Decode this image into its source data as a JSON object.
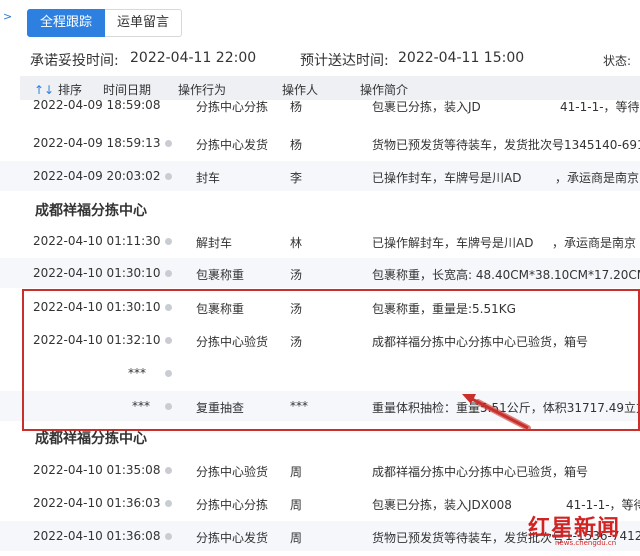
{
  "tabs": [
    {
      "label": "全程跟踪"
    },
    {
      "label": "运单留言"
    }
  ],
  "info": {
    "promise_label": "承诺妥投时间:",
    "promise_value": "2022-04-11 22:00",
    "eta_label": "预计送达时间:",
    "eta_value": "2022-04-11 15:00",
    "status_label": "状态:"
  },
  "table_header": {
    "sort": "排序",
    "time": "时间日期",
    "action": "操作行为",
    "operator": "操作人",
    "summary": "操作简介"
  },
  "rows_top": [
    {
      "time": "2022-04-09 18:59:08",
      "action": "分拣中心分拣",
      "operator": "杨",
      "summary": "包裹已分拣，装入JD",
      "extra": "41-1-1-，等待"
    },
    {
      "time": "2022-04-09 18:59:13",
      "action": "分拣中心发货",
      "operator": "杨",
      "summary": "货物已预发货等待装车，发货批次号1345140-6915"
    },
    {
      "time": "2022-04-09 20:03:02",
      "action": "封车",
      "operator": "李",
      "summary": "已操作封车，车牌号是川AD",
      "extra": "，承运商是南京"
    }
  ],
  "section1": "成都祥福分拣中心",
  "rows_mid": [
    {
      "time": "2022-04-10 01:11:30",
      "action": "解封车",
      "operator": "林",
      "summary": "已操作解封车，车牌号是川AD",
      "extra": "，承运商是南京"
    },
    {
      "time": "2022-04-10 01:30:10",
      "action": "包裹称重",
      "operator": "汤",
      "summary": "包裹称重，长宽高: 48.40CM*38.10CM*17.20CM"
    }
  ],
  "rows_box": [
    {
      "time": "2022-04-10 01:30:10",
      "action": "包裹称重",
      "operator": "汤",
      "summary": "包裹称重，重量是:5.51KG"
    },
    {
      "time": "2022-04-10 01:32:10",
      "action": "分拣中心验货",
      "operator": "汤",
      "summary": "成都祥福分拣中心分拣中心已验货，箱号"
    },
    {
      "time": "***",
      "action": "",
      "operator": "",
      "summary": ""
    },
    {
      "time": "***",
      "action": "复重抽查",
      "operator": "***",
      "summary": "重量体积抽检：重量5.51公斤，体积31717.49立方"
    }
  ],
  "section2": "成都祥福分拣中心",
  "rows_bottom": [
    {
      "time": "2022-04-10 01:35:08",
      "action": "分拣中心验货",
      "operator": "周",
      "summary": "成都祥福分拣中心分拣中心已验货，箱号"
    },
    {
      "time": "2022-04-10 01:36:03",
      "action": "分拣中心分拣",
      "operator": "周",
      "summary": "包裹已分拣，装入JDX008",
      "extra": "41-1-1-，等待"
    },
    {
      "time": "2022-04-10 01:36:08",
      "action": "分拣中心发货",
      "operator": "周",
      "summary": "货物已预发货等待装车，发货批次号",
      "extra": "1-1536-7412"
    }
  ],
  "logo": {
    "text": "红星新闻",
    "url": "news.chengdu.cn",
    "phone": "sdeed"
  },
  "colors": {
    "accent": "#2d7fe0",
    "highlight": "#c9302c",
    "brand": "#d22323"
  }
}
